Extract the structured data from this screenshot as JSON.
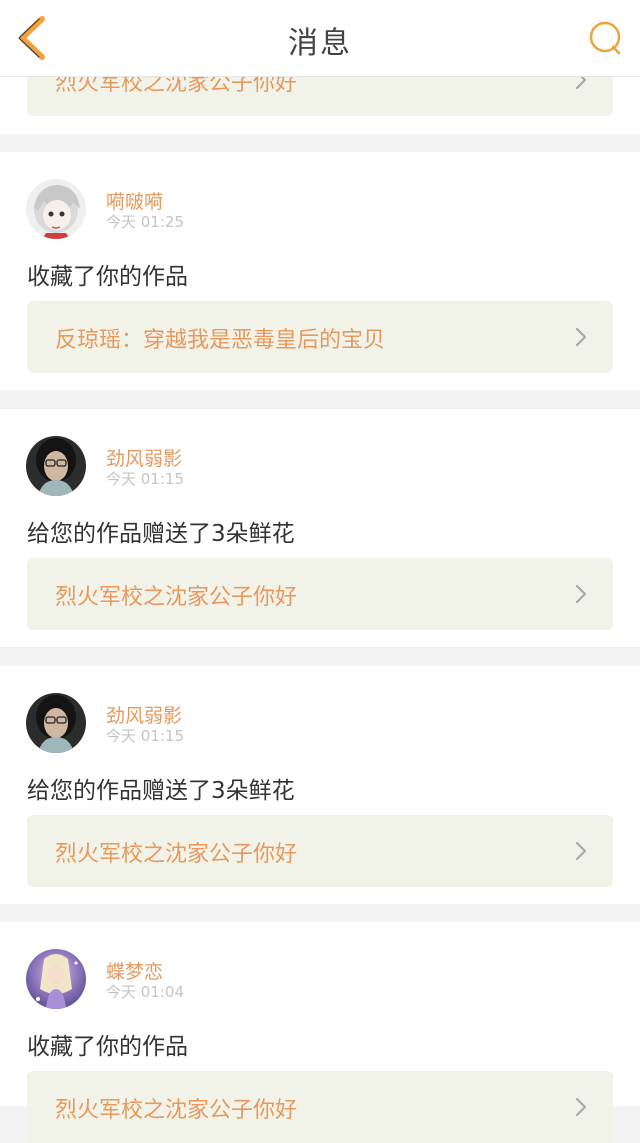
{
  "header": {
    "title": "消息",
    "back_icon": "chevron-left-icon",
    "search_icon": "search-icon",
    "accent_color": "#f2a23a"
  },
  "notifications": [
    {
      "work_title": "烈火军校之沈家公子你好"
    },
    {
      "username": "嗬啵嗬",
      "time": "今天  01:25",
      "action": "收藏了你的作品",
      "work_title": "反琼瑶：穿越我是恶毒皇后的宝贝"
    },
    {
      "username": "劲风弱影",
      "time": "今天  01:15",
      "action": "给您的作品赠送了3朵鲜花",
      "work_title": "烈火军校之沈家公子你好"
    },
    {
      "username": "劲风弱影",
      "time": "今天  01:15",
      "action": "给您的作品赠送了3朵鲜花",
      "work_title": "烈火军校之沈家公子你好"
    },
    {
      "username": "蝶梦恋",
      "time": "今天  01:04",
      "action": "收藏了你的作品",
      "work_title": "烈火军校之沈家公子你好"
    }
  ],
  "colors": {
    "username": "#e5995e",
    "work_link_bg": "#f2f3e8",
    "timestamp": "#c4c4c4"
  }
}
